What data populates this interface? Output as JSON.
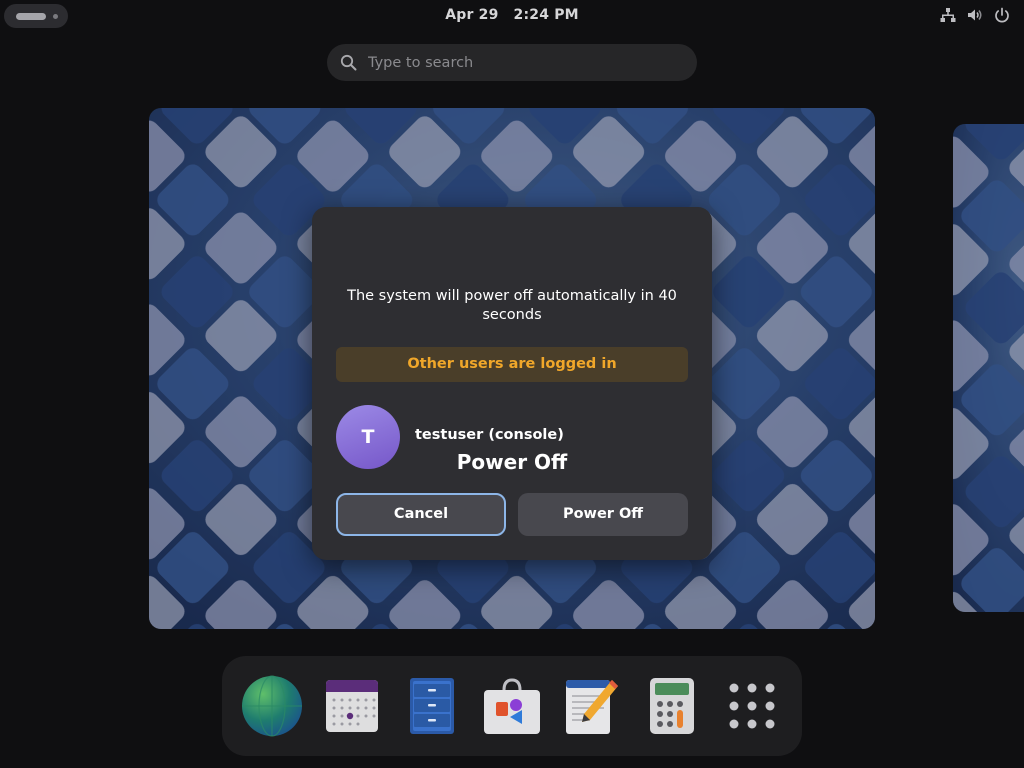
{
  "topbar": {
    "date": "Apr 29",
    "time": "2:24 PM",
    "tray_icons": [
      "network-icon",
      "volume-icon",
      "power-icon"
    ]
  },
  "search": {
    "placeholder": "Type to search"
  },
  "dialog": {
    "title": "Power Off",
    "message": "The system will power off automatically in 40 seconds",
    "warning": "Other users are logged in",
    "user": {
      "initial": "T",
      "name": "testuser (console)"
    },
    "cancel_label": "Cancel",
    "confirm_label": "Power Off"
  },
  "dock": {
    "apps": [
      {
        "icon": "browser-globe-icon"
      },
      {
        "icon": "calendar-icon"
      },
      {
        "icon": "file-cabinet-icon"
      },
      {
        "icon": "software-store-icon"
      },
      {
        "icon": "text-editor-icon"
      },
      {
        "icon": "calculator-icon"
      },
      {
        "icon": "app-grid-icon"
      }
    ]
  },
  "colors": {
    "warning_text": "#f0a72a",
    "warning_bg": "#4a3e29",
    "focus_ring": "#8db6e8",
    "dialog_bg": "#2e2e32",
    "avatar": "#8670d8"
  }
}
